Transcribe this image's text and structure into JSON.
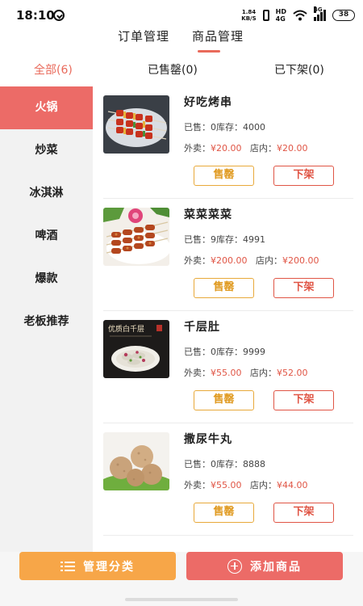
{
  "status_bar": {
    "time": "18:10",
    "net_speed_value": "1.84",
    "net_speed_unit": "KB/S",
    "carrier_line1": "HD",
    "carrier_line2": "4G",
    "signal_tag": "4G",
    "battery": "38"
  },
  "top_tabs": [
    {
      "label": "订单管理"
    },
    {
      "label": "商品管理"
    }
  ],
  "filter_tabs": [
    {
      "label": "全部(6)"
    },
    {
      "label": "已售罄(0)"
    },
    {
      "label": "已下架(0)"
    }
  ],
  "sidebar": {
    "items": [
      {
        "label": "火锅"
      },
      {
        "label": "炒菜"
      },
      {
        "label": "冰淇淋"
      },
      {
        "label": "啤酒"
      },
      {
        "label": "爆款"
      },
      {
        "label": "老板推荐"
      }
    ]
  },
  "product_labels": {
    "sold": "已售：",
    "stock": "库存：",
    "takeout": "外卖：",
    "dinein": "店内：",
    "sold_out_button": "售罄",
    "off_shelf_button": "下架"
  },
  "products": [
    {
      "name": "好吃烤串",
      "sold": "0",
      "stock": "4000",
      "takeout_price": "¥20.00",
      "dinein_price": "¥20.00",
      "image": "skewers-photo"
    },
    {
      "name": "菜菜菜菜",
      "sold": "9",
      "stock": "4991",
      "takeout_price": "¥200.00",
      "dinein_price": "¥200.00",
      "image": "grilled-meat-photo"
    },
    {
      "name": "千层肚",
      "sold": "0",
      "stock": "9999",
      "takeout_price": "¥55.00",
      "dinein_price": "¥52.00",
      "image": "tripe-photo",
      "image_text": "优质白千层"
    },
    {
      "name": "撒尿牛丸",
      "sold": "0",
      "stock": "8888",
      "takeout_price": "¥55.00",
      "dinein_price": "¥44.00",
      "image": "beef-balls-photo"
    }
  ],
  "bottom_bar": {
    "manage_label": "管理分类",
    "add_label": "添加商品"
  },
  "colors": {
    "accent": "#ec6b67",
    "orange": "#f7a648",
    "price_red": "#e05545",
    "sidebar_bg": "#f2f2f2"
  }
}
